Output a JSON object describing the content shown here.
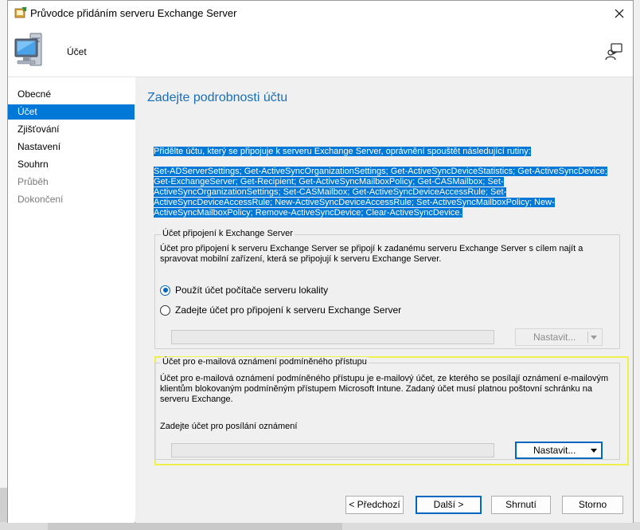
{
  "window": {
    "title": "Průvodce přidáním serveru Exchange Server",
    "header_title": "Účet"
  },
  "sidebar": {
    "items": [
      {
        "label": "Obecné",
        "state": "normal"
      },
      {
        "label": "Účet",
        "state": "active"
      },
      {
        "label": "Zjišťování",
        "state": "normal"
      },
      {
        "label": "Nastavení",
        "state": "normal"
      },
      {
        "label": "Souhrn",
        "state": "normal"
      },
      {
        "label": "Průběh",
        "state": "disabled"
      },
      {
        "label": "Dokončení",
        "state": "disabled"
      }
    ]
  },
  "main": {
    "title": "Zadejte podrobnosti účtu",
    "intro": "Přidělte účtu, který se připojuje k serveru Exchange Server, oprávnění spouštět následující rutiny:",
    "cmdlets": "Set-ADServerSettings; Get-ActiveSyncOrganizationSettings; Get-ActiveSyncDeviceStatistics; Get-ActiveSyncDevice; Get-ExchangeServer; Get-Recipient; Get-ActiveSyncMailboxPolicy; Get-CASMailbox; Set-ActiveSyncOrganizationSettings; Set-CASMailbox; Get-ActiveSyncDeviceAccessRule; Set-ActiveSyncDeviceAccessRule; New-ActiveSyncDeviceAccessRule; Set-ActiveSyncMailboxPolicy; New-ActiveSyncMailboxPolicy; Remove-ActiveSyncDevice; Clear-ActiveSyncDevice.",
    "connect_group": {
      "title": "Účet připojení k Exchange Server",
      "description": "Účet pro připojení k serveru Exchange Server se připojí k zadanému serveru Exchange Server s cílem najít a spravovat mobilní zařízení, která se připojují k serveru Exchange Server.",
      "radio_local": "Použít účet počítače serveru lokality",
      "radio_custom": "Zadejte účet pro připojení k serveru Exchange Server",
      "account_value": "",
      "set_button": "Nastavit..."
    },
    "notify_group": {
      "title": "Účet pro e-mailová oznámení podmíněného přístupu",
      "description": "Účet pro e-mailová oznámení podmíněného přístupu je e-mailový účet, ze kterého se posílají oznámení e-mailovým klientům blokovaným podmíněným přístupem Microsoft Intune. Zadaný účet musí platnou poštovní schránku na serveru Exchange.",
      "field_label": "Zadejte účet pro posílání oznámení",
      "account_value": "",
      "set_button": "Nastavit..."
    }
  },
  "footer": {
    "back": "< Předchozí",
    "next": "Další >",
    "summary": "Shrnutí",
    "cancel": "Storno"
  }
}
